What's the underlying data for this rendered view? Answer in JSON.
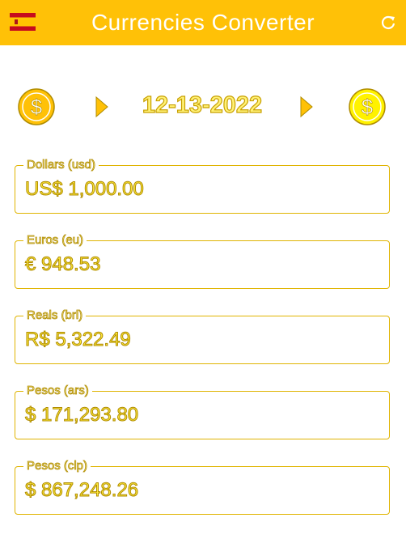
{
  "header": {
    "title": "Currencies Converter",
    "accent": "#FFC107"
  },
  "date_row": {
    "date": "12-13-2022",
    "left_icon": "dollar-coin-icon",
    "right_icon": "dollar-coin-icon"
  },
  "fields": [
    {
      "label": "Dollars (usd)",
      "value": "US$ 1,000.00"
    },
    {
      "label": "Euros (eu)",
      "value": "€ 948.53"
    },
    {
      "label": "Reals (brl)",
      "value": "R$ 5,322.49"
    },
    {
      "label": "Pesos (ars)",
      "value": "$ 171,293.80"
    },
    {
      "label": "Pesos (clp)",
      "value": "$ 867,248.26"
    }
  ]
}
